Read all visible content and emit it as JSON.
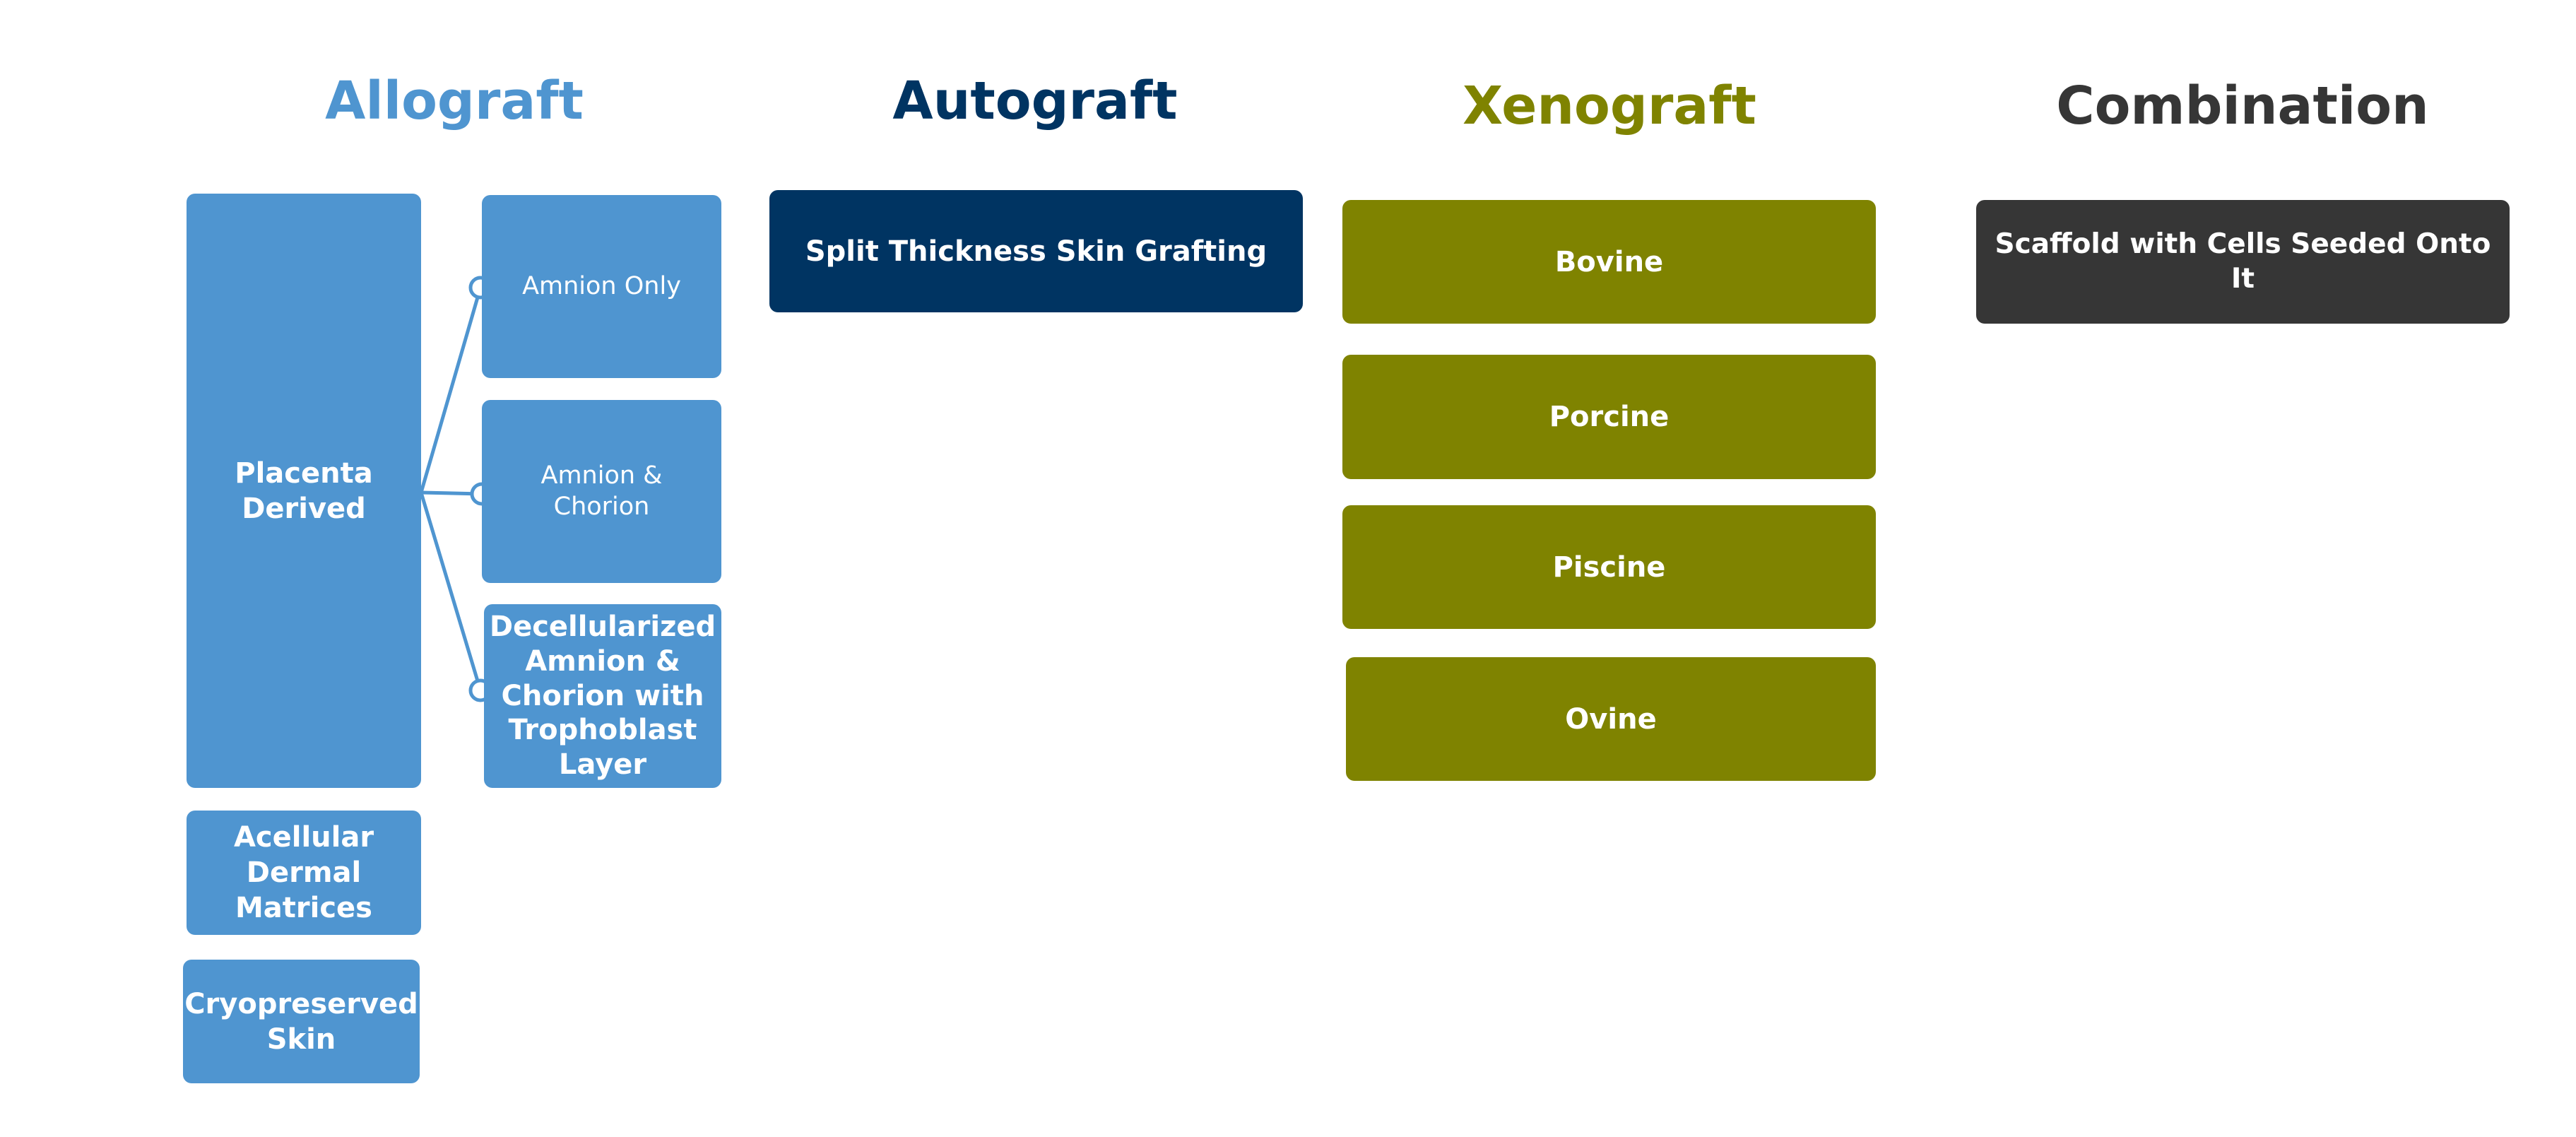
{
  "colors": {
    "allograft": "#4f95d0",
    "autograft": "#003462",
    "xenograft": "#7f8300",
    "combination": "#363636"
  },
  "allograft": {
    "title": "Allograft",
    "placenta": "Placenta Derived",
    "placenta_children": [
      "Amnion Only",
      "Amnion & Chorion",
      "Decellularized Amnion & Chorion with Trophoblast Layer"
    ],
    "others": [
      "Acellular Dermal Matrices",
      "Cryopreserved Skin"
    ]
  },
  "autograft": {
    "title": "Autograft",
    "items": [
      "Split Thickness Skin Grafting"
    ]
  },
  "xenograft": {
    "title": "Xenograft",
    "items": [
      "Bovine",
      "Porcine",
      "Piscine",
      "Ovine"
    ]
  },
  "combination": {
    "title": "Combination",
    "items": [
      "Scaffold with Cells Seeded Onto It"
    ]
  }
}
